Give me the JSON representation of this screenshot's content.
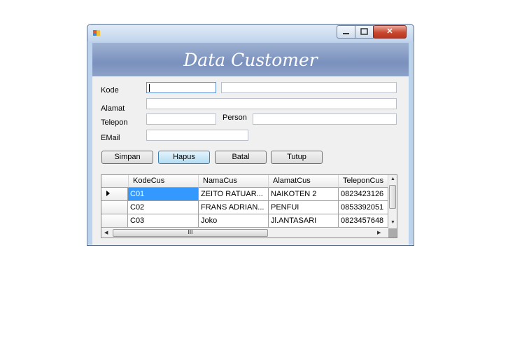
{
  "window": {
    "icon": "app-icon",
    "controls": {
      "minimize_icon": "minimize-icon",
      "maximize_icon": "maximize-icon",
      "close_icon": "close-icon",
      "close_glyph": "✕"
    }
  },
  "banner": {
    "title": "Data Customer"
  },
  "form": {
    "kode": {
      "label": "Kode",
      "value": ""
    },
    "kode_name": {
      "value": ""
    },
    "alamat": {
      "label": "Alamat",
      "value": ""
    },
    "telepon": {
      "label": "Telepon",
      "value": ""
    },
    "person": {
      "label": "Person",
      "value": ""
    },
    "email": {
      "label": "EMail",
      "value": ""
    }
  },
  "buttons": {
    "simpan": "Simpan",
    "hapus": "Hapus",
    "batal": "Batal",
    "tutup": "Tutup"
  },
  "grid": {
    "columns": [
      "KodeCus",
      "NamaCus",
      "AlamatCus",
      "TeleponCus"
    ],
    "rows": [
      [
        "C01",
        "ZEITO RATUAR...",
        "NAIKOTEN 2",
        "0823423126"
      ],
      [
        "C02",
        "FRANS ADRIAN...",
        "PENFUI",
        "0853392051"
      ],
      [
        "C03",
        "Joko",
        "Jl.ANTASARI",
        "0823457648"
      ]
    ],
    "selected_row": 0,
    "scroll_thumb_glyph": "III"
  },
  "colors": {
    "banner": "#8a9fc8",
    "selection": "#3399ff",
    "close_button": "#c9482f"
  }
}
